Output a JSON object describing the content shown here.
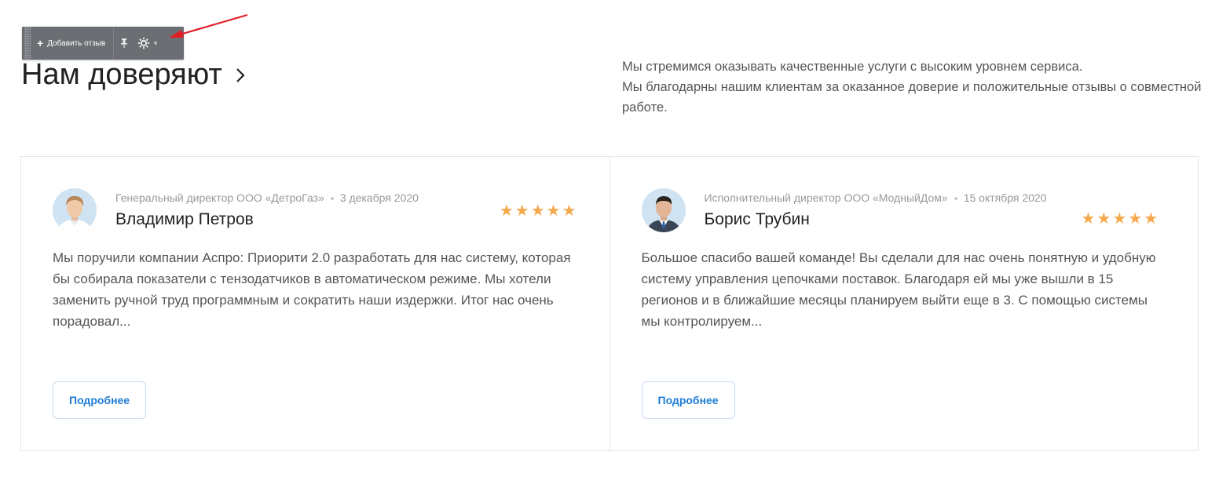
{
  "toolbar": {
    "add_label": "Добавить отзыв",
    "add_icon": "plus-icon",
    "pin_icon": "pin-icon",
    "settings_icon": "gear-icon"
  },
  "section": {
    "title": "Нам доверяют",
    "intro": [
      "Мы стремимся оказывать качественные услуги с высоким уровнем сервиса.",
      "Мы благодарны нашим клиентам за оказанное доверие и положительные отзывы о совместной работе."
    ]
  },
  "reviews": [
    {
      "position": "Генеральный директор ООО «ДетроГаз»",
      "date": "3 декабря 2020",
      "name": "Владимир Петров",
      "stars": "★★★★★",
      "rating": 5,
      "text": "Мы поручили компании Аспро: Приорити 2.0 разработать для нас систему, которая бы собирала показатели с тензодатчиков в автоматическом режиме. Мы хотели заменить ручной труд программным и сократить наши издержки. Итог нас очень порадовал...",
      "button": "Подробнее"
    },
    {
      "position": "Исполнительный директор ООО «МодныйДом»",
      "date": "15 октября 2020",
      "name": "Борис Трубин",
      "stars": "★★★★★",
      "rating": 5,
      "text": "Большое спасибо вашей команде! Вы сделали для нас очень понятную и удобную систему управления цепочками поставок. Благодаря ей мы уже вышли в 15 регионов и в ближайшие месяцы планируем выйти еще в 3. С помощью системы мы контролируем...",
      "button": "Подробнее"
    }
  ],
  "colors": {
    "accent": "#1f7cd6",
    "stars": "#f6a94c",
    "toolbar_bg": "#6b6e73",
    "arrow": "#e31e24"
  }
}
